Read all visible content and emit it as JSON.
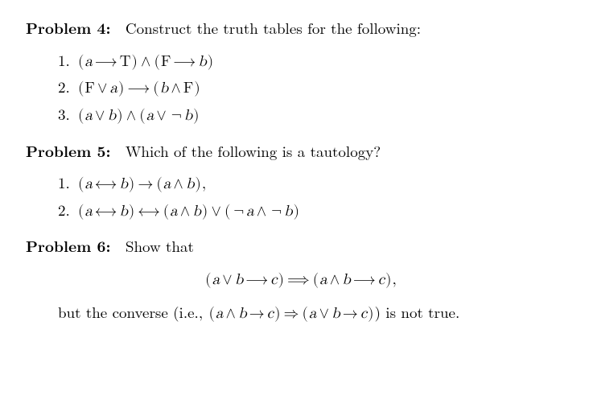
{
  "problems": {
    "p4": {
      "label": "Problem 4:",
      "prompt": "Construct the truth tables for the following:",
      "items": {
        "n1": "1.",
        "e1": "(a ⟶ T) ∧ (F ⟶ b)",
        "n2": "2.",
        "e2": "(F ∨ a) ⟶ (b ∧ F)",
        "n3": "3.",
        "e3": "(a ∨ b) ∧ (a ∨ ¬b)"
      }
    },
    "p5": {
      "label": "Problem 5:",
      "prompt": "Which of the following is a tautology?",
      "items": {
        "n1": "1.",
        "e1": "(a ⟷ b) → (a ∧ b),",
        "n2": "2.",
        "e2": "(a ⟷ b) ⟷ (a ∧ b) ∨ (¬a ∧ ¬b)"
      }
    },
    "p6": {
      "label": "Problem 6:",
      "prompt": "Show that",
      "display": "(a ∨ b ⟶ c) ⟹ (a ∧ b ⟶ c),",
      "followup_pre": "but the converse (i.e., ",
      "followup_math": "(a ∧ b → c) ⇒ (a ∨ b → c)",
      "followup_post": ") is not true."
    }
  }
}
